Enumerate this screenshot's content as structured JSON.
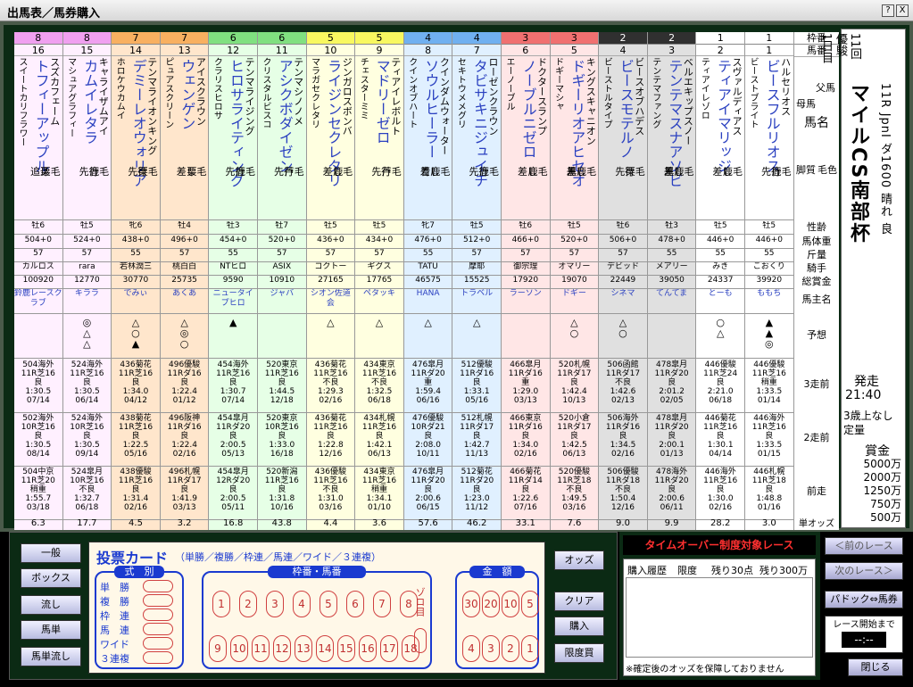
{
  "window": {
    "title": "出馬表／馬券購入",
    "help": "?",
    "close": "X"
  },
  "race": {
    "kaisai": [
      "11回",
      "優駿",
      "1日目"
    ],
    "title": "マイルCS南部杯",
    "racenum": "11R",
    "grade": "JpnI",
    "course": "ダ1600",
    "weather": "晴れ",
    "track": "良",
    "post_label": "発走",
    "post_time": "21:40",
    "cond": "3歳上なし",
    "cond2": "定量",
    "prize_label": "賞金",
    "prizes": [
      "5000万",
      "2000万",
      "1250万",
      "750万",
      "500万"
    ]
  },
  "labels": {
    "waku": "枠番",
    "umaban": "馬番",
    "chichi": "父馬",
    "meisho": "馬名",
    "haha": "母馬",
    "keshoku": "毛色",
    "kyakushitsu": "脚質",
    "seirei": "性齢",
    "bataiju": "馬体重",
    "kinryo": "斤量",
    "kishu": "騎手",
    "sokaku": "総賞金",
    "banushimei": "馬主名",
    "yoso": "予想",
    "z3": "3走前",
    "z2": "2走前",
    "z1": "前走",
    "odds": "単オッズ"
  },
  "horses": [
    {
      "waku": "8",
      "no": "16",
      "sire": "スズカフェーム",
      "name": "トフィーアップル",
      "dam": "スイートカリフラワー",
      "coat": "栗毛",
      "style": "追込",
      "sex": "牡6",
      "wt": "504+0",
      "kin": "57",
      "jockey": "カルロス",
      "prize": "100920",
      "owner": "鈴鹿レースクラブ",
      "mark": "",
      "z3": "504海外\n11R芝16\n良\n1:30.5\n07/14",
      "z2": "502海外\n10R芝16\n良\n1:30.5\n08/14",
      "z1": "504中京\n11R芝20\n稍重\n1:55.7\n03/18",
      "odds": "6.3"
    },
    {
      "waku": "8",
      "no": "15",
      "sire": "キャライザムアイ",
      "name": "カムイレタラ",
      "dam": "マシュアグラフィー",
      "coat": "鹿毛",
      "style": "先行",
      "sex": "牡5",
      "wt": "524+0",
      "kin": "57",
      "jockey": "rara",
      "prize": "12770",
      "owner": "キララ",
      "mark": "◎\n△\n△",
      "z3": "524海外\n11R芝16\n良\n1:30.5\n06/14",
      "z2": "524海外\n10R芝16\n良\n1:30.5\n09/14",
      "z1": "524皐月\n10R芝16\n不良\n1:32.7\n06/18",
      "odds": "17.7"
    },
    {
      "waku": "7",
      "no": "14",
      "sire": "テンマライオンキング",
      "name": "デミーレオウォリア",
      "dam": "ホロケウカムイ",
      "coat": "栗毛",
      "style": "先行",
      "sex": "牝6",
      "wt": "438+0",
      "kin": "55",
      "jockey": "若林潤三",
      "prize": "30770",
      "owner": "でみぃ",
      "mark": "△\n○\n▲",
      "z3": "436菊花\n11R芝16\n良\n1:34.0\n04/12",
      "z2": "438菊花\n11R芝16\n良\n1:22.5\n05/16",
      "z1": "438優駿\n11R芝16\n良\n1:31.4\n02/16",
      "odds": "4.5"
    },
    {
      "waku": "7",
      "no": "13",
      "sire": "アイスクラウン",
      "name": "ウェンゲン",
      "dam": "ピュアスクリーン",
      "coat": "栗毛",
      "style": "差し",
      "sex": "牡4",
      "wt": "496+0",
      "kin": "57",
      "jockey": "桃白白",
      "prize": "25735",
      "owner": "あくあ",
      "mark": "△\n◎\n○",
      "z3": "496優駿\n11Rダ16\n良\n1:22.4\n01/12",
      "z2": "496阪神\n11Rダ16\n良\n1:22.4\n02/16",
      "z1": "496札幌\n11Rダ17\n良\n1:41.9\n03/13",
      "odds": "3.2"
    },
    {
      "waku": "6",
      "no": "12",
      "sire": "テンマライジング",
      "name": "ヒロサライティング",
      "dam": "クラリスヒロサ",
      "coat": "鹿毛",
      "style": "先行",
      "sex": "牡3",
      "wt": "454+0",
      "kin": "55",
      "jockey": "NTヒロ",
      "prize": "9590",
      "owner": "ニュータイプヒロ",
      "mark": "▲",
      "z3": "454海外\n11R芝16\n良\n1:30.7\n07/14",
      "z2": "454皐月\n11Rダ20\n良\n2:00.5\n05/13",
      "z1": "454皐月\n12Rダ20\n良\n2:00.5\n05/11",
      "odds": "16.8"
    },
    {
      "waku": "6",
      "no": "11",
      "sire": "テンマシノノメ",
      "name": "アシクボダイゼン",
      "dam": "クリスタルビスコ",
      "coat": "芦毛",
      "style": "先行",
      "sex": "牡7",
      "wt": "520+0",
      "kin": "57",
      "jockey": "ASIX",
      "prize": "10910",
      "owner": "ジャバ",
      "mark": "",
      "z3": "520東京\n11R芝16\n良\n1:44.5\n12/18",
      "z2": "520東京\n10R芝16\n良\n1:33.0\n16/18",
      "z1": "520新潟\n11R芝16\n良\n1:31.8\n10/16",
      "odds": "43.8"
    },
    {
      "waku": "5",
      "no": "10",
      "sire": "ジンガロスボンバ",
      "name": "ライジンセクレタリ",
      "dam": "マラガセクレタリ",
      "coat": "鹿毛",
      "style": "差し",
      "sex": "牡5",
      "wt": "436+0",
      "kin": "57",
      "jockey": "コクトー",
      "prize": "27165",
      "owner": "シオン佐道会",
      "mark": "△",
      "z3": "436菊花\n11R芝16\n不良\n1:29.3\n02/16",
      "z2": "436菊花\n11R芝16\n良\n1:22.8\n12/16",
      "z1": "436優駿\n11R芝16\n不良\n1:31.0\n03/16",
      "odds": "4.4"
    },
    {
      "waku": "5",
      "no": "9",
      "sire": "ティアイレボルト",
      "name": "マドリーゼロ",
      "dam": "チェスターミミ",
      "coat": "芦毛",
      "style": "先行",
      "sex": "牡5",
      "wt": "434+0",
      "kin": "57",
      "jockey": "ギグス",
      "prize": "17765",
      "owner": "ペタッキ",
      "mark": "△",
      "z3": "434東京\n11R芝16\n不良\n1:32.5\n06/18",
      "z2": "434札幌\n11R芝16\n良\n1:42.1\n06/13",
      "z1": "434東京\n11R芝16\n稍重\n1:34.1\n01/10",
      "odds": "3.6"
    },
    {
      "waku": "4",
      "no": "8",
      "sire": "クインダムウォーター",
      "name": "ソウルヒーラー",
      "dam": "クインオブハート",
      "coat": "青鹿毛",
      "style": "差し",
      "sex": "牝7",
      "wt": "476+0",
      "kin": "55",
      "jockey": "TATU",
      "prize": "46575",
      "owner": "HANA",
      "mark": "△",
      "z3": "476皐月\n11Rダ20\n重\n1:59.4\n06/16",
      "z2": "476優駿\n10Rダ21\n良\n2:08.0\n10/11",
      "z1": "476皐月\n11Rダ20\n良\n2:00.6\n06/15",
      "odds": "57.6"
    },
    {
      "waku": "4",
      "no": "7",
      "sire": "ローゼンクラウン",
      "name": "タビサキニジュイチ",
      "dam": "セキトウメメグリ",
      "coat": "鹿毛",
      "style": "先行",
      "sex": "牡5",
      "wt": "512+0",
      "kin": "57",
      "jockey": "摩耶",
      "prize": "15525",
      "owner": "トラベル",
      "mark": "△",
      "z3": "512優駿\n11Rダ16\n良\n1:33.1\n05/16",
      "z2": "512札幌\n11Rダ17\n良\n1:42.7\n11/13",
      "z1": "512菊花\n11Rダ20\n良\n1:23.0\n11/12",
      "odds": "46.2"
    },
    {
      "waku": "3",
      "no": "6",
      "sire": "ドクタースランプ",
      "name": "ノーブルニゼロ",
      "dam": "エーノーブル",
      "coat": "鹿毛",
      "style": "差し",
      "sex": "牡6",
      "wt": "466+0",
      "kin": "57",
      "jockey": "御宗理",
      "prize": "17920",
      "owner": "ラーソン",
      "mark": "",
      "z3": "466皐月\n11Rダ16\n重\n1:29.0\n03/13",
      "z2": "466東京\n11Rダ16\n良\n1:34.0\n02/16",
      "z1": "466菊花\n11Rダ14\n良\n1:22.6\n07/16",
      "odds": "33.1"
    },
    {
      "waku": "3",
      "no": "5",
      "sire": "キングスキャニオン",
      "name": "ドギーリオアヒセオ",
      "dam": "ドギーマシャ",
      "coat": "黒鹿毛",
      "style": "差し",
      "sex": "牡5",
      "wt": "520+0",
      "kin": "57",
      "jockey": "オマリー",
      "prize": "19070",
      "owner": "ドギー",
      "mark": "△\n○",
      "z3": "520札幌\n11Rダ17\n良\n1:42.4\n10/13",
      "z2": "520小倉\n11Rダ17\n良\n1:42.5\n06/13",
      "z1": "520優駿\n11R芝18\n不良\n1:49.5\n03/16",
      "odds": "7.6"
    },
    {
      "waku": "2",
      "no": "4",
      "sire": "ビースオブハデス",
      "name": "ビースモテルノ",
      "dam": "ビーストルタイプ",
      "coat": "栗毛",
      "style": "先行",
      "sex": "牡6",
      "wt": "506+0",
      "kin": "57",
      "jockey": "デビッド",
      "prize": "22449",
      "owner": "シネマ",
      "mark": "△\n○",
      "z3": "506函館\n11Rダ17\n不良\n1:42.6\n02/13",
      "z2": "506海外\n11Rダ16\n良\n1:34.5\n02/16",
      "z1": "506優駿\n11Rダ18\n不良\n1:50.4\n12/16",
      "odds": "9.0"
    },
    {
      "waku": "2",
      "no": "3",
      "sire": "ベルエキップスノー",
      "name": "テンテマスナアソビ",
      "dam": "テンテマファング",
      "coat": "黒鹿毛",
      "style": "差し",
      "sex": "牡3",
      "wt": "478+0",
      "kin": "55",
      "jockey": "メアリー",
      "prize": "39050",
      "owner": "てんてま",
      "mark": "",
      "z3": "478皐月\n11Rダ20\n良\n2:01.2\n02/05",
      "z2": "478皐月\n11Rダ20\n良\n2:00.1\n01/13",
      "z1": "478海外\n11Rダ20\n良\n2:00.6\n06/11",
      "odds": "9.9"
    },
    {
      "waku": "1",
      "no": "2",
      "sire": "スヴァルディアス",
      "name": "ティアイマリッジ",
      "dam": "ティアイレゾロ",
      "coat": "鹿毛",
      "style": "差し",
      "sex": "牡5",
      "wt": "446+0",
      "kin": "55",
      "jockey": "みき",
      "prize": "24337",
      "owner": "とーも",
      "mark": "○\n△",
      "z3": "446優駿\n11R芝24\n良\n2:21.0\n06/18",
      "z2": "446菊花\n11R芝16\n良\n1:30.1\n04/14",
      "z1": "446海外\n11R芝16\n良\n1:30.0\n02/16",
      "odds": "28.2"
    },
    {
      "waku": "1",
      "no": "1",
      "sire": "ハルセリオス",
      "name": "ビースフルリオス",
      "dam": "ビーストブライト",
      "coat": "鹿毛",
      "style": "先行",
      "sex": "牡5",
      "wt": "446+0",
      "kin": "55",
      "jockey": "こおくり",
      "prize": "39920",
      "owner": "ももち",
      "mark": "▲\n▲\n◎",
      "z3": "446優駿\n11R芝16\n稍重\n1:33.5\n01/14",
      "z2": "446海外\n11R芝16\n良\n1:33.5\n01/15",
      "z1": "446札幌\n11R芝18\n良\n1:48.8\n01/16",
      "odds": "3.0"
    }
  ],
  "wakucolors": {
    "8": "#f0a0f0",
    "7": "#f8b060",
    "6": "#80e080",
    "5": "#f8f860",
    "4": "#70b0f0",
    "3": "#f07070",
    "2": "#303030",
    "1": "#ffffff"
  },
  "wakubg": {
    "8": "#fff0ff",
    "7": "#ffe6cc",
    "6": "#e6ffe6",
    "5": "#ffffe0",
    "4": "#e0f0ff",
    "3": "#ffe6e6",
    "2": "#e0e0e0",
    "1": "#ffffff"
  },
  "panel": {
    "left": [
      "一般",
      "ボックス",
      "流し",
      "馬単",
      "馬単流し"
    ],
    "card_title": "投票カード",
    "card_sub": "（単勝／複勝／枠連／馬連／ワイド／３連複）",
    "shiki_label": "式　別",
    "shiki": [
      "単　勝",
      "複　勝",
      "枠　連",
      "馬　連",
      "ワイド",
      "３連複"
    ],
    "umaban_label": "枠番・馬番",
    "row1": [
      "1",
      "2",
      "3",
      "4",
      "5",
      "6",
      "7",
      "8"
    ],
    "row2": [
      "9",
      "10",
      "11",
      "12",
      "13",
      "14",
      "15",
      "16",
      "17",
      "18"
    ],
    "zoro": "ゾロ目",
    "kingaku_label": "金　額",
    "kin1": [
      "30",
      "20",
      "10",
      "5"
    ],
    "kin2": [
      "4",
      "3",
      "2",
      "1"
    ],
    "buttons": [
      "オッズ",
      "クリア",
      "購入",
      "限度買"
    ]
  },
  "right": {
    "timeover": "タイムオーバー制度対象レース",
    "rireki": "購入履歴",
    "gendo": "限度",
    "nokori1": "残り30点",
    "nokori2": "残り300万",
    "note": "※確定後のオッズを保障しておりません"
  },
  "nav": {
    "prev": "＜前のレース",
    "next": "次のレース＞",
    "paddock": "パドック⇔馬券",
    "start_label": "レース開始まで",
    "timer": "--:--",
    "close": "閉じる"
  }
}
